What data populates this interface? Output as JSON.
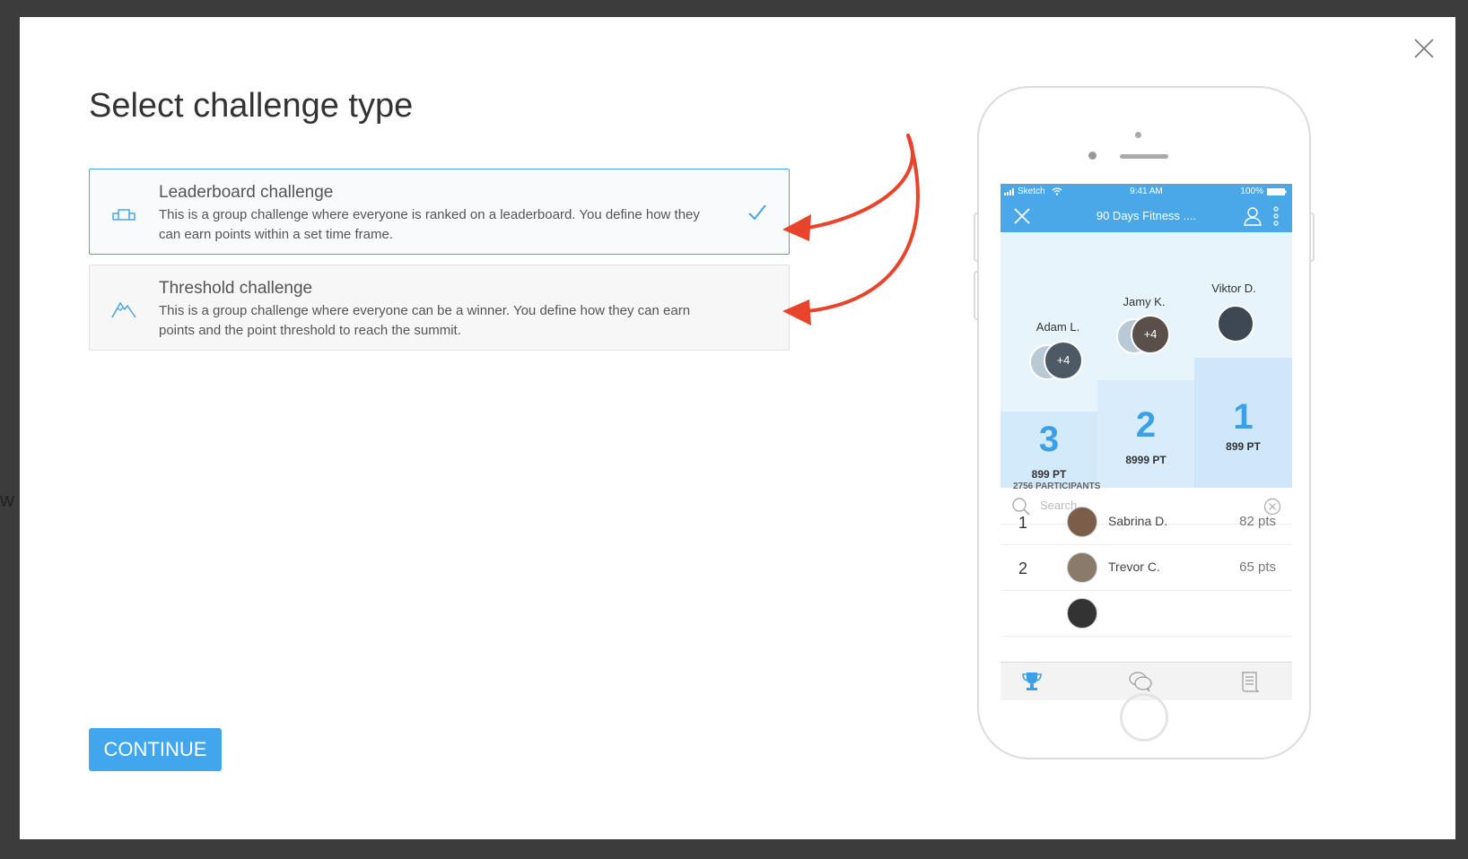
{
  "background": {
    "fragment": "w"
  },
  "modal": {
    "title": "Select challenge type",
    "options": [
      {
        "title": "Leaderboard challenge",
        "description": "This is a group challenge where everyone is ranked on a leaderboard. You define how they can earn points within a set time frame.",
        "icon": "podium-icon",
        "selected": true
      },
      {
        "title": "Threshold challenge",
        "description": "This is a group challenge where everyone can be a winner. You define how they can earn points and the point threshold to reach the summit.",
        "icon": "mountain-icon",
        "selected": false
      }
    ],
    "continue_label": "CONTINUE",
    "accent_color": "#42a6ee",
    "arrow_color": "#e8442b"
  },
  "phone": {
    "status": {
      "carrier": "Sketch",
      "time": "9:41 AM",
      "battery": "100%"
    },
    "nav_title": "90 Days Fitness ....",
    "podium": [
      {
        "place": "1",
        "name": "Viktor D.",
        "points": "899 PT"
      },
      {
        "place": "2",
        "name": "Jamy K.",
        "points": "8999 PT"
      },
      {
        "place": "3",
        "name": "Adam L.",
        "points": "899 PT"
      }
    ],
    "group_badge": "+4",
    "search_placeholder": "Search",
    "participants_label": "2756 PARTICIPANTS",
    "leaderboard": [
      {
        "rank": "1",
        "name": "Sabrina D.",
        "points": "82 pts"
      },
      {
        "rank": "2",
        "name": "Trevor C.",
        "points": "65 pts"
      }
    ]
  }
}
